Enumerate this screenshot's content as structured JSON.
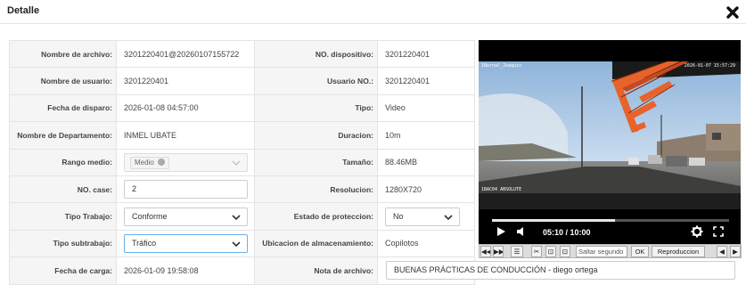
{
  "dialog": {
    "title": "Detalle"
  },
  "rows": [
    {
      "l1": "Nombre de archivo:",
      "v1": "3201220401@20260107155722",
      "l2": "NO. dispositivo:",
      "v2": "3201220401"
    },
    {
      "l1": "Nombre de usuario:",
      "v1": "3201220401",
      "l2": "Usuario NO.:",
      "v2": "3201220401"
    },
    {
      "l1": "Fecha de disparo:",
      "v1": "2026-01-08 04:57:00",
      "l2": "Tipo:",
      "v2": "Video"
    },
    {
      "l1": "Nombre de Departamento:",
      "v1": "INMEL UBATE",
      "l2": "Duracion:",
      "v2": "10m"
    },
    {
      "l1": "Rango medio:",
      "v1_chip": "Medio",
      "l2": "Tamaño:",
      "v2": "88.46MB"
    },
    {
      "l1": "NO. case:",
      "v1_input": "2",
      "l2": "Resolucion:",
      "v2": "1280X720"
    },
    {
      "l1": "Tipo Trabajo:",
      "v1_select": "Conforme",
      "l2": "Estado de proteccion:",
      "v2_select": "No"
    },
    {
      "l1": "Tipo subtrabajo:",
      "v1_select": "Tráfico",
      "l2": "Ubicacion de almacenamiento:",
      "v2": "Copilotos"
    },
    {
      "l1": "Fecha de carga:",
      "v1": "2026-01-09 19:58:08",
      "l2": "Nota de archivo:",
      "v2_input": "BUENAS PRÁCTICAS DE CONDUCCIÓN - diego ortega"
    }
  ],
  "player": {
    "time": "05:10 / 10:00",
    "progress": 0.517,
    "osd_top_left": "1Bernal_Joaquin",
    "osd_top_right": "2026-01-07 15:57:29",
    "osd_bottom_left": "1BAC04 ABSOLUTE",
    "icons": {
      "play": "play-icon",
      "volume": "volume-icon",
      "settings": "gear-icon",
      "fullscreen": "fullscreen-icon"
    }
  },
  "toolbar": {
    "rewind": "◀◀",
    "forward": "▶▶",
    "list": "☰",
    "cut": "✂",
    "cap1": "⊡",
    "cap2": "⊡",
    "seek_placeholder": "Saltar segundo",
    "ok": "OK",
    "rate": "Reproduccion",
    "prev": "◀",
    "next": "▶"
  },
  "colors": {
    "accent": "#66afe9",
    "label_bg": "#f5f5f5",
    "border": "#e4e4e4",
    "crane": "#e8622a",
    "sky": "#a9c6e3"
  }
}
